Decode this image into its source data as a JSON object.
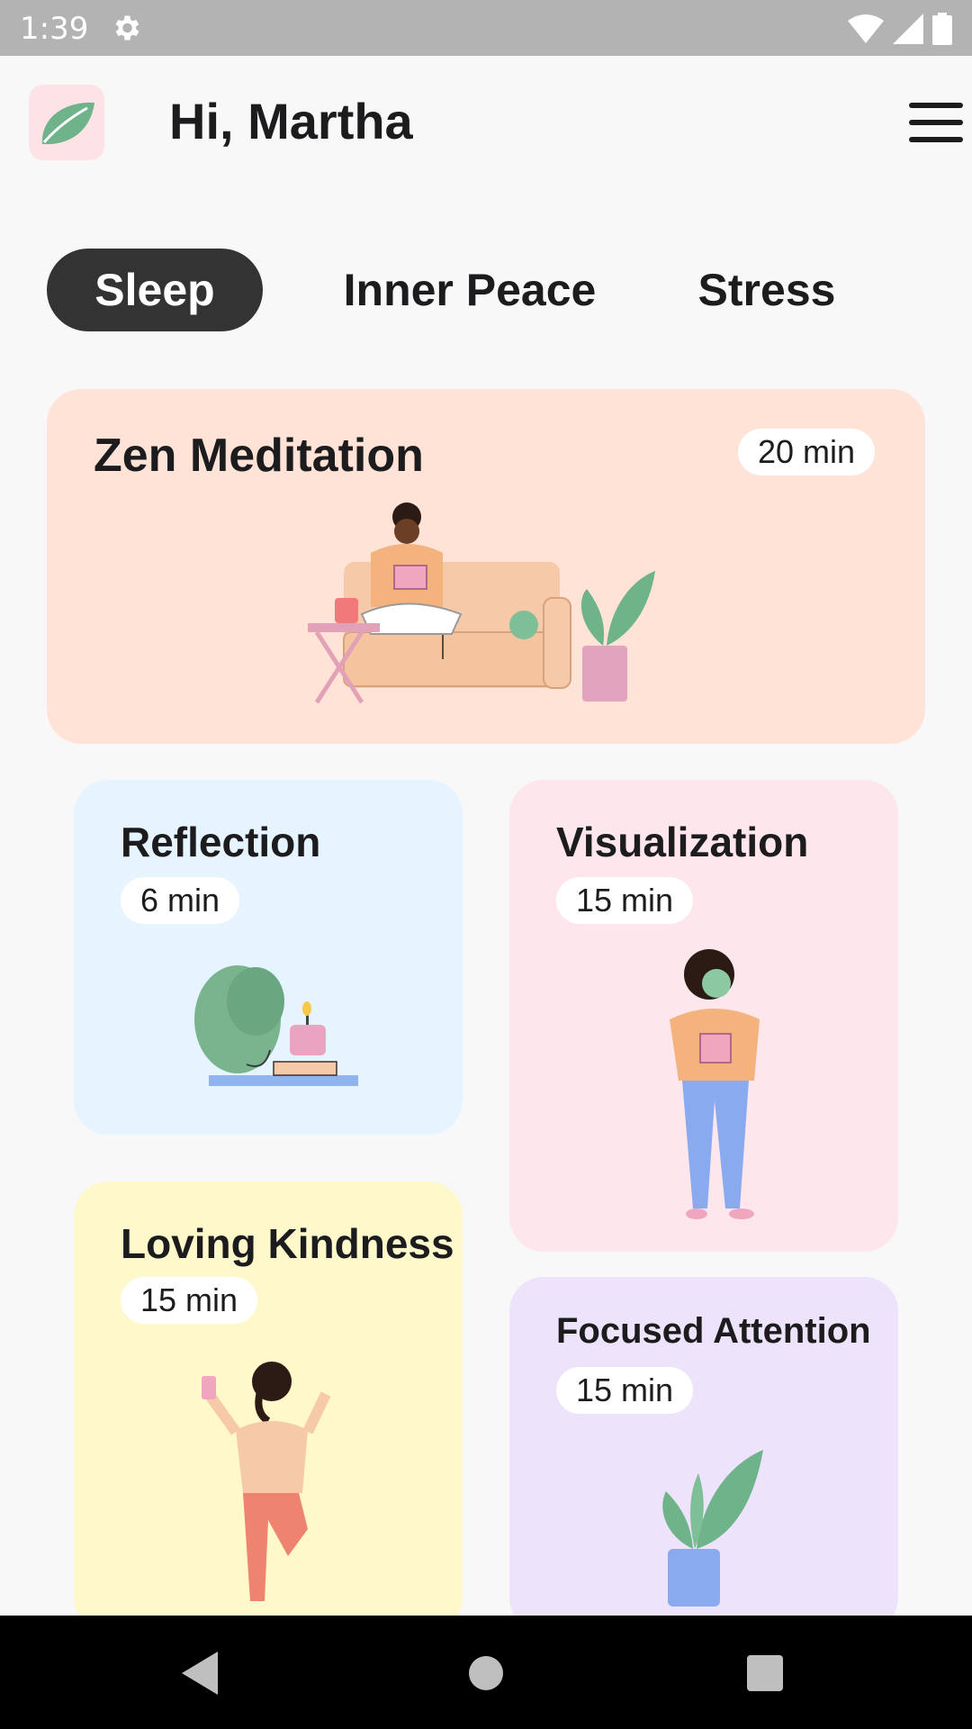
{
  "status_bar": {
    "time": "1:39"
  },
  "header": {
    "greeting": "Hi, Martha"
  },
  "tabs": [
    {
      "label": "Sleep",
      "active": true
    },
    {
      "label": "Inner Peace",
      "active": false
    },
    {
      "label": "Stress",
      "active": false
    }
  ],
  "cards": {
    "zen": {
      "title": "Zen Meditation",
      "duration": "20 min",
      "color": "#ffe3d6"
    },
    "reflection": {
      "title": "Reflection",
      "duration": "6 min",
      "color": "#e6f4ff"
    },
    "visualization": {
      "title": "Visualization",
      "duration": "15 min",
      "color": "#fde6ec"
    },
    "loving": {
      "title": "Loving Kindness",
      "duration": "15 min",
      "color": "#fef8cb"
    },
    "focused": {
      "title": "Focused Attention",
      "duration": "15 min",
      "color": "#ede4fb"
    }
  },
  "icons": {
    "logo": "leaf-icon",
    "menu": "hamburger-menu-icon",
    "nav_back": "back-triangle-icon",
    "nav_home": "home-circle-icon",
    "nav_recents": "recents-square-icon"
  }
}
